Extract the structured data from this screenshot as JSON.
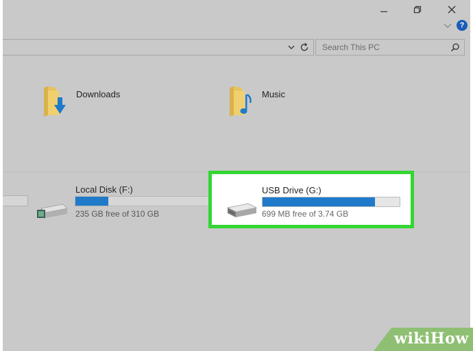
{
  "window": {
    "controls": {
      "minimize_icon": "minimize-icon",
      "maximize_icon": "restore-icon",
      "close_icon": "close-icon",
      "ribbon_toggle_icon": "chevron-down-icon",
      "help_label": "?"
    }
  },
  "address_bar": {
    "dropdown_icon": "chevron-down-icon",
    "refresh_icon": "refresh-icon"
  },
  "search": {
    "placeholder": "Search This PC",
    "icon": "search-icon"
  },
  "folders": [
    {
      "label": "Downloads",
      "icon": "downloads-folder-icon"
    },
    {
      "label": "Music",
      "icon": "music-folder-icon"
    }
  ],
  "drives": [
    {
      "name": "Local Disk (F:)",
      "free_text": "235 GB free of 310 GB",
      "used_fraction": 0.24,
      "icon": "hard-drive-icon"
    },
    {
      "name": "USB Drive (G:)",
      "free_text": "699 MB free of 3.74 GB",
      "used_fraction": 0.82,
      "icon": "usb-drive-icon",
      "highlighted": true
    }
  ],
  "colors": {
    "highlight_border": "#33d633",
    "bar_fill": "#1f7ac9",
    "background": "#c9c9c9",
    "watermark_bg": "#8fbf73"
  },
  "watermark": {
    "text": "wikiHow"
  }
}
